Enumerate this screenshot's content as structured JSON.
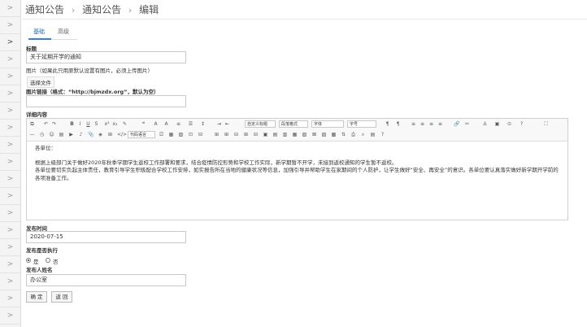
{
  "sidebar": {
    "items": [
      ">",
      ">",
      ">",
      ">",
      ">",
      ">",
      ">",
      ">",
      ">",
      ">",
      ">",
      ">",
      ">",
      ">",
      ">",
      ">",
      ">",
      ">",
      ">"
    ]
  },
  "breadcrumb": {
    "level1": "通知公告",
    "level2": "通知公告",
    "level3": "编辑",
    "separator": "›"
  },
  "tabs": {
    "basic": "基础",
    "advanced": "高级"
  },
  "form": {
    "title_label": "标题",
    "title_value": "关于延期开学的通知",
    "image_label": "图片（如果此只用原默认设置有图片，必须上传图片）",
    "choose_file": "选择文件",
    "link_label": "图片链接（格式：“http://bjmzdx.org”，默认为空）",
    "link_value": "",
    "detail_label": "详细内容",
    "date_label": "发布时间",
    "date_value": "2020-07-15",
    "publish_label": "发布是否执行",
    "radio_yes": "是",
    "radio_no": "否",
    "author_label": "发布人姓名",
    "author_value": "办公室",
    "confirm_btn": "确 定",
    "back_btn": "返 回"
  },
  "toolbar": {
    "font_format": "自定义标题",
    "paragraph": "段落格式",
    "font_family": "字体",
    "font_size": "字号",
    "code_lang": "代码语言",
    "icons": [
      "html-icon",
      "undo-icon",
      "redo-icon",
      "bold-icon",
      "italic-icon",
      "underline-icon"
    ]
  },
  "editor": {
    "greeting": "各单位：",
    "para1": "根据上级部门关于做好2020年秋季学期学生返校工作部署和要求，结合疫情防控形势和学校工作实际，新学期暂不开学，未接到返校通知的学生暂不返校。",
    "para2": "各单位要切实负起主体责任，教育引导学生积极配合学校工作安排，如实报告所在当地的健康状况等信息，加强引导并帮助学生在家期间的个人防护，让学生做好“安全、再安全”的意识。各单位要认真落实做好新学期开学前的各项准备工作。"
  }
}
